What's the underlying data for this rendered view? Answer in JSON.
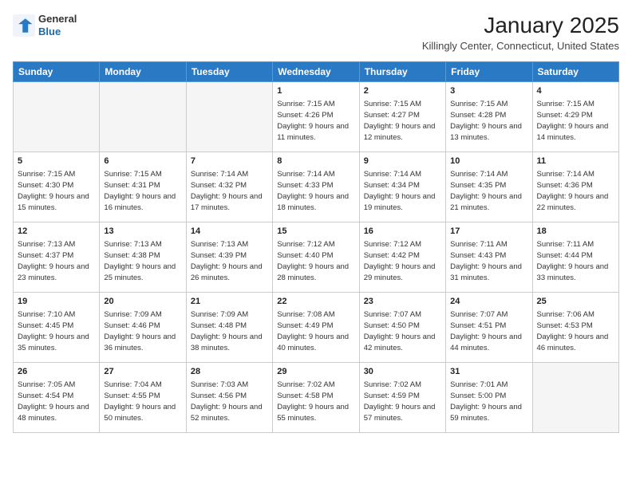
{
  "logo": {
    "line1": "General",
    "line2": "Blue"
  },
  "title": "January 2025",
  "subtitle": "Killingly Center, Connecticut, United States",
  "days_of_week": [
    "Sunday",
    "Monday",
    "Tuesday",
    "Wednesday",
    "Thursday",
    "Friday",
    "Saturday"
  ],
  "weeks": [
    [
      {
        "day": "",
        "sunrise": "",
        "sunset": "",
        "daylight": "",
        "empty": true
      },
      {
        "day": "",
        "sunrise": "",
        "sunset": "",
        "daylight": "",
        "empty": true
      },
      {
        "day": "",
        "sunrise": "",
        "sunset": "",
        "daylight": "",
        "empty": true
      },
      {
        "day": "1",
        "sunrise": "Sunrise: 7:15 AM",
        "sunset": "Sunset: 4:26 PM",
        "daylight": "Daylight: 9 hours and 11 minutes.",
        "empty": false
      },
      {
        "day": "2",
        "sunrise": "Sunrise: 7:15 AM",
        "sunset": "Sunset: 4:27 PM",
        "daylight": "Daylight: 9 hours and 12 minutes.",
        "empty": false
      },
      {
        "day": "3",
        "sunrise": "Sunrise: 7:15 AM",
        "sunset": "Sunset: 4:28 PM",
        "daylight": "Daylight: 9 hours and 13 minutes.",
        "empty": false
      },
      {
        "day": "4",
        "sunrise": "Sunrise: 7:15 AM",
        "sunset": "Sunset: 4:29 PM",
        "daylight": "Daylight: 9 hours and 14 minutes.",
        "empty": false
      }
    ],
    [
      {
        "day": "5",
        "sunrise": "Sunrise: 7:15 AM",
        "sunset": "Sunset: 4:30 PM",
        "daylight": "Daylight: 9 hours and 15 minutes.",
        "empty": false
      },
      {
        "day": "6",
        "sunrise": "Sunrise: 7:15 AM",
        "sunset": "Sunset: 4:31 PM",
        "daylight": "Daylight: 9 hours and 16 minutes.",
        "empty": false
      },
      {
        "day": "7",
        "sunrise": "Sunrise: 7:14 AM",
        "sunset": "Sunset: 4:32 PM",
        "daylight": "Daylight: 9 hours and 17 minutes.",
        "empty": false
      },
      {
        "day": "8",
        "sunrise": "Sunrise: 7:14 AM",
        "sunset": "Sunset: 4:33 PM",
        "daylight": "Daylight: 9 hours and 18 minutes.",
        "empty": false
      },
      {
        "day": "9",
        "sunrise": "Sunrise: 7:14 AM",
        "sunset": "Sunset: 4:34 PM",
        "daylight": "Daylight: 9 hours and 19 minutes.",
        "empty": false
      },
      {
        "day": "10",
        "sunrise": "Sunrise: 7:14 AM",
        "sunset": "Sunset: 4:35 PM",
        "daylight": "Daylight: 9 hours and 21 minutes.",
        "empty": false
      },
      {
        "day": "11",
        "sunrise": "Sunrise: 7:14 AM",
        "sunset": "Sunset: 4:36 PM",
        "daylight": "Daylight: 9 hours and 22 minutes.",
        "empty": false
      }
    ],
    [
      {
        "day": "12",
        "sunrise": "Sunrise: 7:13 AM",
        "sunset": "Sunset: 4:37 PM",
        "daylight": "Daylight: 9 hours and 23 minutes.",
        "empty": false
      },
      {
        "day": "13",
        "sunrise": "Sunrise: 7:13 AM",
        "sunset": "Sunset: 4:38 PM",
        "daylight": "Daylight: 9 hours and 25 minutes.",
        "empty": false
      },
      {
        "day": "14",
        "sunrise": "Sunrise: 7:13 AM",
        "sunset": "Sunset: 4:39 PM",
        "daylight": "Daylight: 9 hours and 26 minutes.",
        "empty": false
      },
      {
        "day": "15",
        "sunrise": "Sunrise: 7:12 AM",
        "sunset": "Sunset: 4:40 PM",
        "daylight": "Daylight: 9 hours and 28 minutes.",
        "empty": false
      },
      {
        "day": "16",
        "sunrise": "Sunrise: 7:12 AM",
        "sunset": "Sunset: 4:42 PM",
        "daylight": "Daylight: 9 hours and 29 minutes.",
        "empty": false
      },
      {
        "day": "17",
        "sunrise": "Sunrise: 7:11 AM",
        "sunset": "Sunset: 4:43 PM",
        "daylight": "Daylight: 9 hours and 31 minutes.",
        "empty": false
      },
      {
        "day": "18",
        "sunrise": "Sunrise: 7:11 AM",
        "sunset": "Sunset: 4:44 PM",
        "daylight": "Daylight: 9 hours and 33 minutes.",
        "empty": false
      }
    ],
    [
      {
        "day": "19",
        "sunrise": "Sunrise: 7:10 AM",
        "sunset": "Sunset: 4:45 PM",
        "daylight": "Daylight: 9 hours and 35 minutes.",
        "empty": false
      },
      {
        "day": "20",
        "sunrise": "Sunrise: 7:09 AM",
        "sunset": "Sunset: 4:46 PM",
        "daylight": "Daylight: 9 hours and 36 minutes.",
        "empty": false
      },
      {
        "day": "21",
        "sunrise": "Sunrise: 7:09 AM",
        "sunset": "Sunset: 4:48 PM",
        "daylight": "Daylight: 9 hours and 38 minutes.",
        "empty": false
      },
      {
        "day": "22",
        "sunrise": "Sunrise: 7:08 AM",
        "sunset": "Sunset: 4:49 PM",
        "daylight": "Daylight: 9 hours and 40 minutes.",
        "empty": false
      },
      {
        "day": "23",
        "sunrise": "Sunrise: 7:07 AM",
        "sunset": "Sunset: 4:50 PM",
        "daylight": "Daylight: 9 hours and 42 minutes.",
        "empty": false
      },
      {
        "day": "24",
        "sunrise": "Sunrise: 7:07 AM",
        "sunset": "Sunset: 4:51 PM",
        "daylight": "Daylight: 9 hours and 44 minutes.",
        "empty": false
      },
      {
        "day": "25",
        "sunrise": "Sunrise: 7:06 AM",
        "sunset": "Sunset: 4:53 PM",
        "daylight": "Daylight: 9 hours and 46 minutes.",
        "empty": false
      }
    ],
    [
      {
        "day": "26",
        "sunrise": "Sunrise: 7:05 AM",
        "sunset": "Sunset: 4:54 PM",
        "daylight": "Daylight: 9 hours and 48 minutes.",
        "empty": false
      },
      {
        "day": "27",
        "sunrise": "Sunrise: 7:04 AM",
        "sunset": "Sunset: 4:55 PM",
        "daylight": "Daylight: 9 hours and 50 minutes.",
        "empty": false
      },
      {
        "day": "28",
        "sunrise": "Sunrise: 7:03 AM",
        "sunset": "Sunset: 4:56 PM",
        "daylight": "Daylight: 9 hours and 52 minutes.",
        "empty": false
      },
      {
        "day": "29",
        "sunrise": "Sunrise: 7:02 AM",
        "sunset": "Sunset: 4:58 PM",
        "daylight": "Daylight: 9 hours and 55 minutes.",
        "empty": false
      },
      {
        "day": "30",
        "sunrise": "Sunrise: 7:02 AM",
        "sunset": "Sunset: 4:59 PM",
        "daylight": "Daylight: 9 hours and 57 minutes.",
        "empty": false
      },
      {
        "day": "31",
        "sunrise": "Sunrise: 7:01 AM",
        "sunset": "Sunset: 5:00 PM",
        "daylight": "Daylight: 9 hours and 59 minutes.",
        "empty": false
      },
      {
        "day": "",
        "sunrise": "",
        "sunset": "",
        "daylight": "",
        "empty": true
      }
    ]
  ]
}
